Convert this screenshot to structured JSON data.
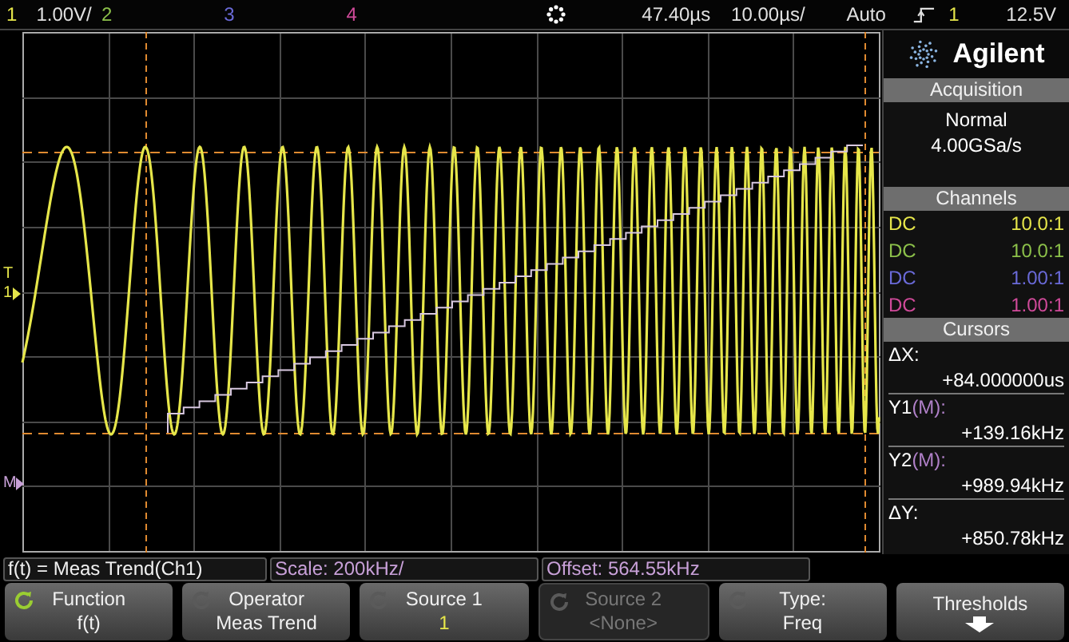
{
  "top_bar": {
    "channels": [
      {
        "label": "1",
        "scale": "1.00V/",
        "color": "#e6e64a"
      },
      {
        "label": "2",
        "color": "#8cc04a"
      },
      {
        "label": "3",
        "color": "#6a6ad8"
      },
      {
        "label": "4",
        "color": "#d04a9a"
      }
    ],
    "time_ref": "47.40µs",
    "timebase": "10.00µs/",
    "trigger_mode": "Auto",
    "trigger_source": "1",
    "trigger_level": "12.5V"
  },
  "plot": {
    "markers": [
      {
        "kind": "trigger",
        "label": "T"
      },
      {
        "kind": "channel",
        "label": "1"
      },
      {
        "kind": "math",
        "label": "M"
      }
    ]
  },
  "sidebar": {
    "brand": "Agilent",
    "acquisition": {
      "title": "Acquisition",
      "mode": "Normal",
      "rate": "4.00GSa/s"
    },
    "channels": {
      "title": "Channels",
      "rows": [
        {
          "coupling": "DC",
          "probe": "10.0:1",
          "color": "#e6e64a"
        },
        {
          "coupling": "DC",
          "probe": "10.0:1",
          "color": "#8cc04a"
        },
        {
          "coupling": "DC",
          "probe": "1.00:1",
          "color": "#6a6ad8"
        },
        {
          "coupling": "DC",
          "probe": "1.00:1",
          "color": "#d04a9a"
        }
      ]
    },
    "cursors": {
      "title": "Cursors",
      "rows": [
        {
          "label": "ΔX:",
          "value": "+84.000000us"
        },
        {
          "label": "Y1",
          "source": "(M):",
          "value": "+139.16kHz"
        },
        {
          "label": "Y2",
          "source": "(M):",
          "value": "+989.94kHz"
        },
        {
          "label": "ΔY:",
          "value": "+850.78kHz"
        }
      ]
    }
  },
  "info_bar": [
    {
      "kind": "function",
      "text": "f(t) = Meas Trend(Ch1)"
    },
    {
      "kind": "math",
      "text": "Scale: 200kHz/"
    },
    {
      "kind": "math",
      "text": "Offset: 564.55kHz"
    }
  ],
  "softkeys": [
    {
      "kind": "cycle",
      "title": "Function",
      "value": "f(t)",
      "active": true,
      "disabled": false
    },
    {
      "kind": "cycle",
      "title": "Operator",
      "value": "Meas Trend",
      "active": false,
      "disabled": false
    },
    {
      "kind": "cycle",
      "title": "Source 1",
      "value": "1",
      "active": false,
      "disabled": false,
      "color": "#e6e64a"
    },
    {
      "kind": "cycle",
      "title": "Source 2",
      "value": "<None>",
      "active": false,
      "disabled": true
    },
    {
      "kind": "cycle",
      "title": "Type:",
      "value": "Freq",
      "active": false,
      "disabled": false
    },
    {
      "kind": "menu",
      "title": "Thresholds",
      "disabled": false
    }
  ]
}
